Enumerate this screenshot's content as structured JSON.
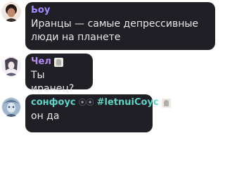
{
  "messages": [
    {
      "author": "Ьоу",
      "author_color": "#a58bff",
      "text": "Иранцы — самые депрессивные люди на планете"
    },
    {
      "author": "Чел",
      "author_color": "#b48cf0",
      "text": "Ты иранец?",
      "badge_icon": "sticker-icon"
    },
    {
      "author": "сонфоус",
      "author_color": "#5fd3c6",
      "author_tag": "#letnuiCoyc",
      "text": "он да",
      "link_icon": "link-icon",
      "badge_icon": "sticker-icon"
    }
  ]
}
